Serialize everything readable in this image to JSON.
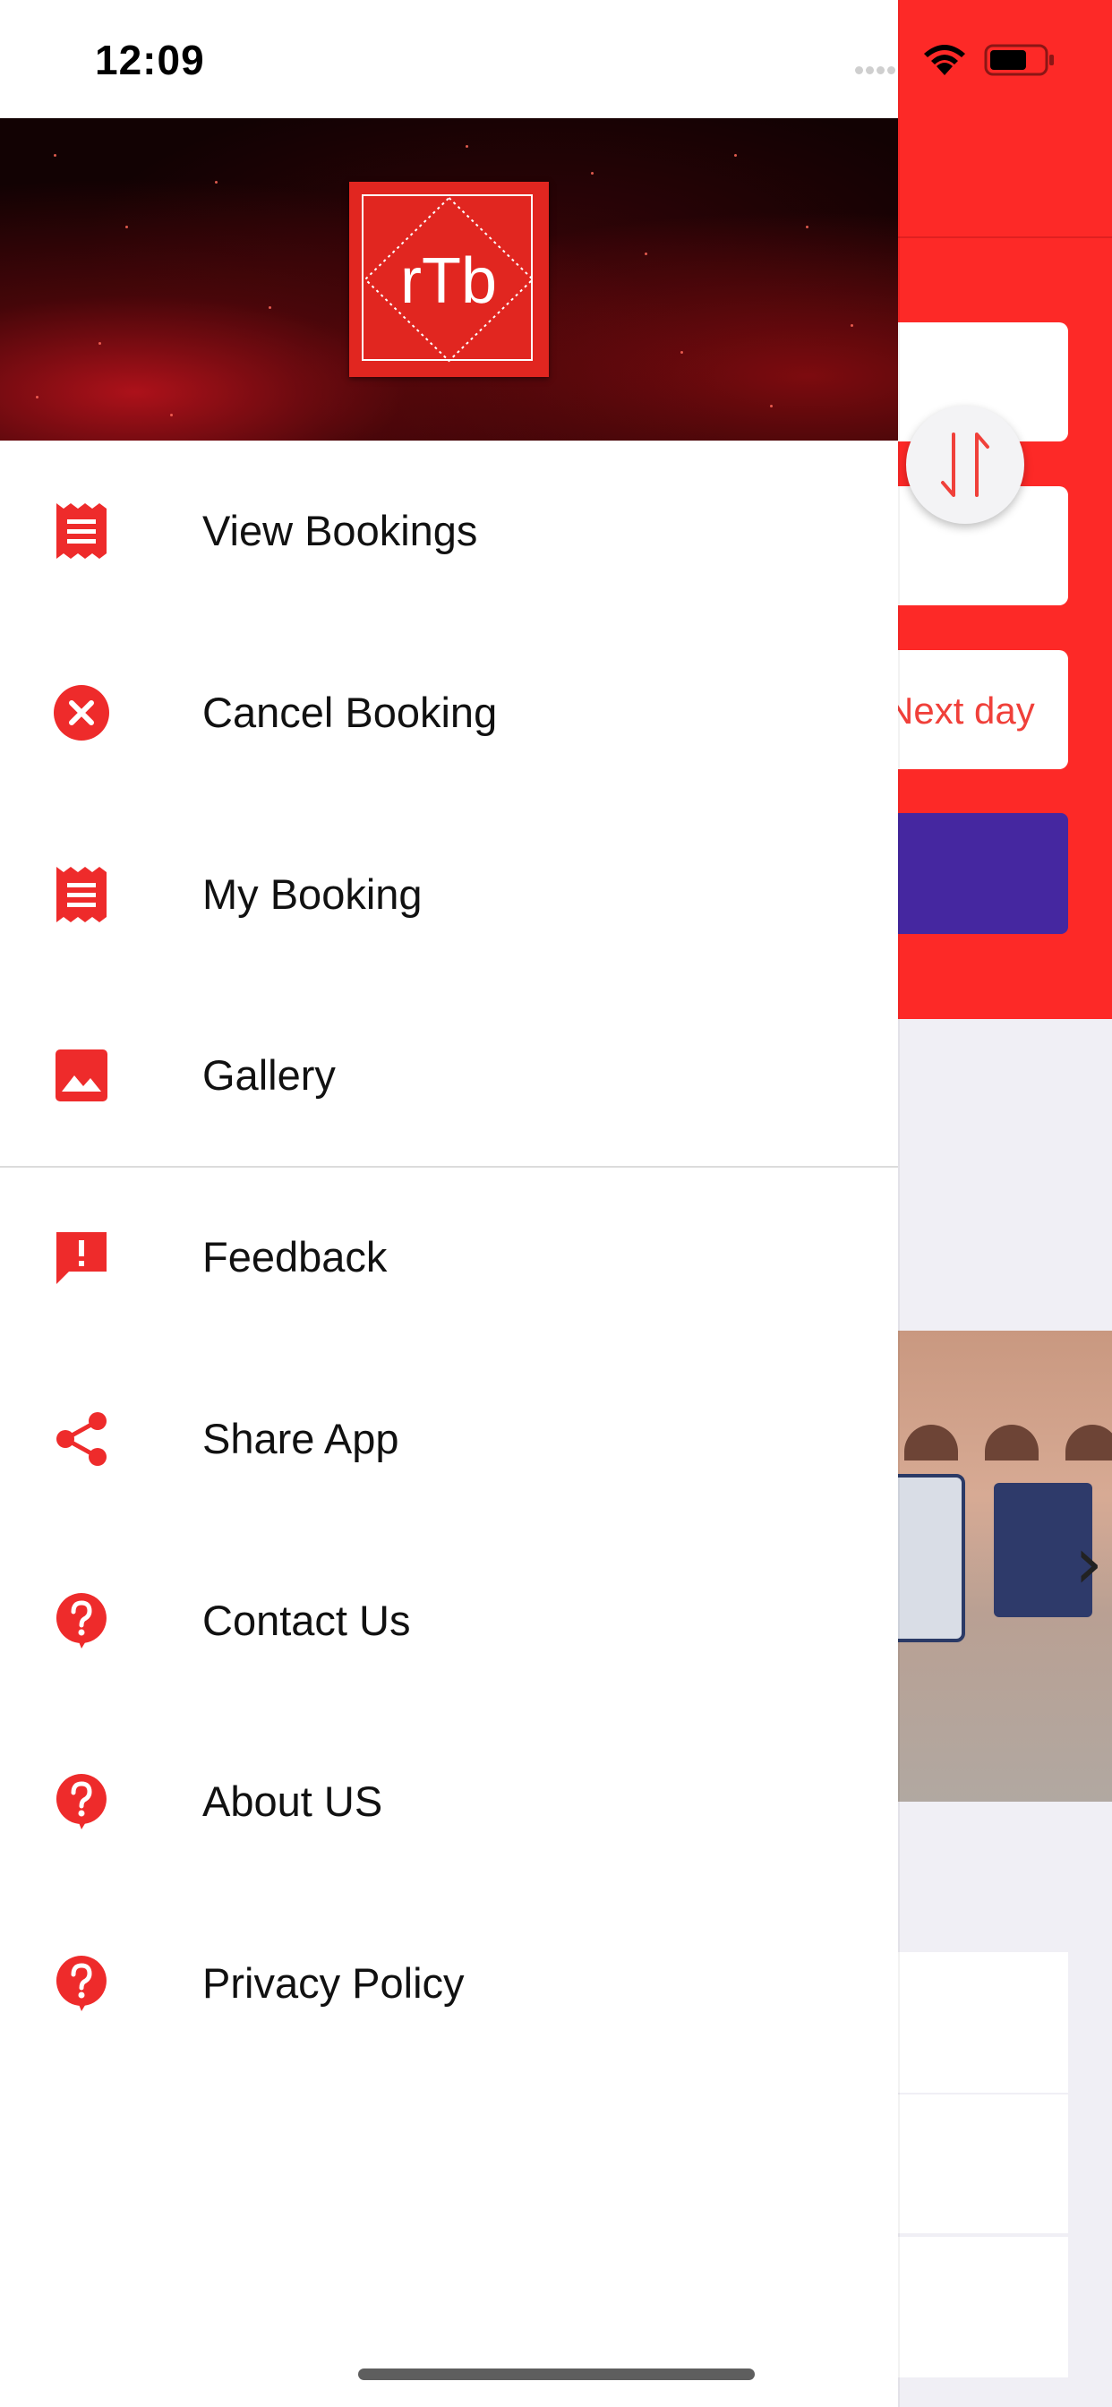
{
  "status_bar": {
    "time": "12:09"
  },
  "header": {
    "logo_text": "rTb"
  },
  "menu": {
    "items": [
      {
        "label": "View Bookings",
        "icon": "receipt-icon"
      },
      {
        "label": "Cancel Booking",
        "icon": "cancel-circle-icon"
      },
      {
        "label": "My Booking",
        "icon": "receipt-icon"
      },
      {
        "label": "Gallery",
        "icon": "image-icon"
      },
      {
        "label": "Feedback",
        "icon": "feedback-icon"
      },
      {
        "label": "Share App",
        "icon": "share-icon"
      },
      {
        "label": "Contact Us",
        "icon": "help-bubble-icon"
      },
      {
        "label": "About US",
        "icon": "help-bubble-icon"
      },
      {
        "label": "Privacy Policy",
        "icon": "help-bubble-icon"
      }
    ]
  },
  "background_app": {
    "date_option": "Next day"
  },
  "colors": {
    "brand_red": "#fd2927",
    "icon_red": "#ee2b2b",
    "search_button": "#4527a0"
  }
}
